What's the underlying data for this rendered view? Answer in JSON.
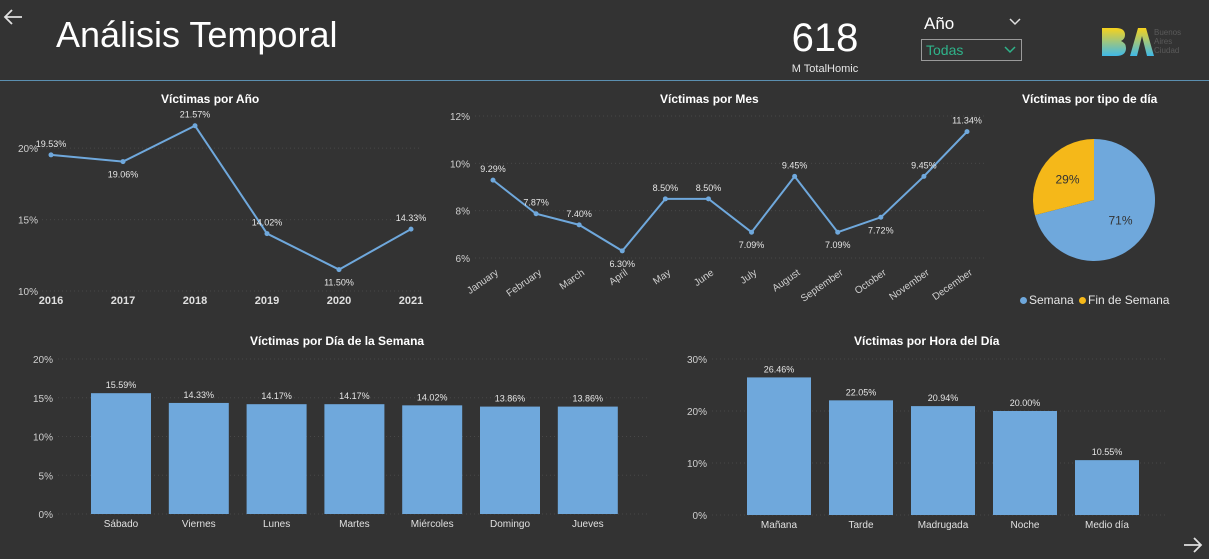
{
  "header": {
    "title": "Análisis Temporal",
    "kpi_value": "618",
    "kpi_label": "M TotalHomic",
    "slicer_title": "Año",
    "slicer_value": "Todas",
    "logo_text": [
      "Buenos",
      "Aires",
      "Ciudad"
    ]
  },
  "icons": {
    "back": "arrow-left-icon",
    "forward": "arrow-right-icon",
    "chevron": "chevron-down-icon"
  },
  "colors": {
    "background": "#333333",
    "series": "#6fa8dc",
    "accent_pie": "#f5b819",
    "slicer_text": "#2fb38a"
  },
  "chart_data": [
    {
      "id": "anio",
      "type": "line",
      "title": "Víctimas por Año",
      "x": [
        "2016",
        "2017",
        "2018",
        "2019",
        "2020",
        "2021"
      ],
      "values": [
        19.53,
        19.06,
        21.57,
        14.02,
        11.5,
        14.33
      ],
      "labels": [
        "19.53%",
        "19.06%",
        "21.57%",
        "14.02%",
        "11.50%",
        "14.33%"
      ],
      "yticks": [
        "10%",
        "15%",
        "20%"
      ],
      "ylim": [
        10,
        22.6
      ]
    },
    {
      "id": "mes",
      "type": "line",
      "title": "Víctimas por Mes",
      "x": [
        "January",
        "February",
        "March",
        "April",
        "May",
        "June",
        "July",
        "August",
        "September",
        "October",
        "November",
        "December"
      ],
      "values": [
        9.29,
        7.87,
        7.4,
        6.3,
        8.5,
        8.5,
        7.09,
        9.45,
        7.09,
        7.72,
        9.45,
        11.34
      ],
      "labels": [
        "9.29%",
        "7.87%",
        "7.40%",
        "6.30%",
        "8.50%",
        "8.50%",
        "7.09%",
        "9.45%",
        "7.09%",
        "7.72%",
        "9.45%",
        "11.34%"
      ],
      "yticks": [
        "6%",
        "8%",
        "10%",
        "12%"
      ],
      "ylim": [
        6,
        12
      ]
    },
    {
      "id": "tipo_dia",
      "type": "pie",
      "title": "Víctimas por tipo de día",
      "slices": [
        {
          "name": "Semana",
          "value": 71,
          "label": "71%",
          "color": "#6fa8dc"
        },
        {
          "name": "Fin de Semana",
          "value": 29,
          "label": "29%",
          "color": "#f5b819"
        }
      ],
      "legend": [
        "Semana",
        "Fin de Semana"
      ]
    },
    {
      "id": "dia_semana",
      "type": "bar",
      "title": "Víctimas por Día de la Semana",
      "categories": [
        "Sábado",
        "Viernes",
        "Lunes",
        "Martes",
        "Miércoles",
        "Domingo",
        "Jueves"
      ],
      "values": [
        15.59,
        14.33,
        14.17,
        14.17,
        14.02,
        13.86,
        13.86
      ],
      "labels": [
        "15.59%",
        "14.33%",
        "14.17%",
        "14.17%",
        "14.02%",
        "13.86%",
        "13.86%"
      ],
      "yticks": [
        "0%",
        "5%",
        "10%",
        "15%",
        "20%"
      ],
      "ylim": [
        0,
        20
      ]
    },
    {
      "id": "hora_dia",
      "type": "bar",
      "title": "Víctimas por Hora del Día",
      "categories": [
        "Mañana",
        "Tarde",
        "Madrugada",
        "Noche",
        "Medio día"
      ],
      "values": [
        26.46,
        22.05,
        20.94,
        20.0,
        10.55
      ],
      "labels": [
        "26.46%",
        "22.05%",
        "20.94%",
        "20.00%",
        "10.55%"
      ],
      "yticks": [
        "0%",
        "10%",
        "20%",
        "30%"
      ],
      "ylim": [
        0,
        30
      ]
    }
  ]
}
